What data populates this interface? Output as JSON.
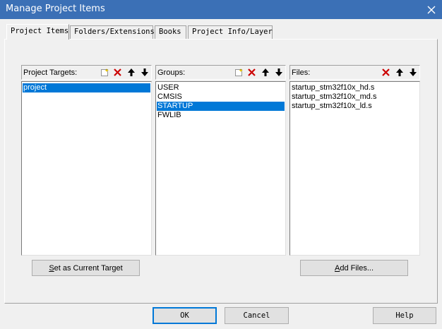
{
  "window": {
    "title": "Manage Project Items"
  },
  "tabs": [
    {
      "label": "Project Items",
      "active": true
    },
    {
      "label": "Folders/Extensions",
      "active": false
    },
    {
      "label": "Books",
      "active": false
    },
    {
      "label": "Project Info/Layer",
      "active": false
    }
  ],
  "targets": {
    "label": "Project Targets:",
    "items": [
      {
        "text": "project",
        "selected": true
      }
    ],
    "button_first": "S",
    "button_rest": "et as Current Target"
  },
  "groups": {
    "label": "Groups:",
    "items": [
      {
        "text": "USER",
        "selected": false
      },
      {
        "text": "CMSIS",
        "selected": false
      },
      {
        "text": "STARTUP",
        "selected": true
      },
      {
        "text": "FWLIB",
        "selected": false
      }
    ]
  },
  "files": {
    "label": "Files:",
    "items": [
      {
        "text": "startup_stm32f10x_hd.s",
        "selected": false
      },
      {
        "text": "startup_stm32f10x_md.s",
        "selected": false
      },
      {
        "text": "startup_stm32f10x_ld.s",
        "selected": false
      }
    ],
    "button_first": "A",
    "button_rest": "dd Files..."
  },
  "footer": {
    "ok": "OK",
    "cancel": "Cancel",
    "help": "Help"
  },
  "colors": {
    "titlebar": "#3b70b6",
    "selection": "#0078d7",
    "delete_icon": "#cc0000"
  }
}
